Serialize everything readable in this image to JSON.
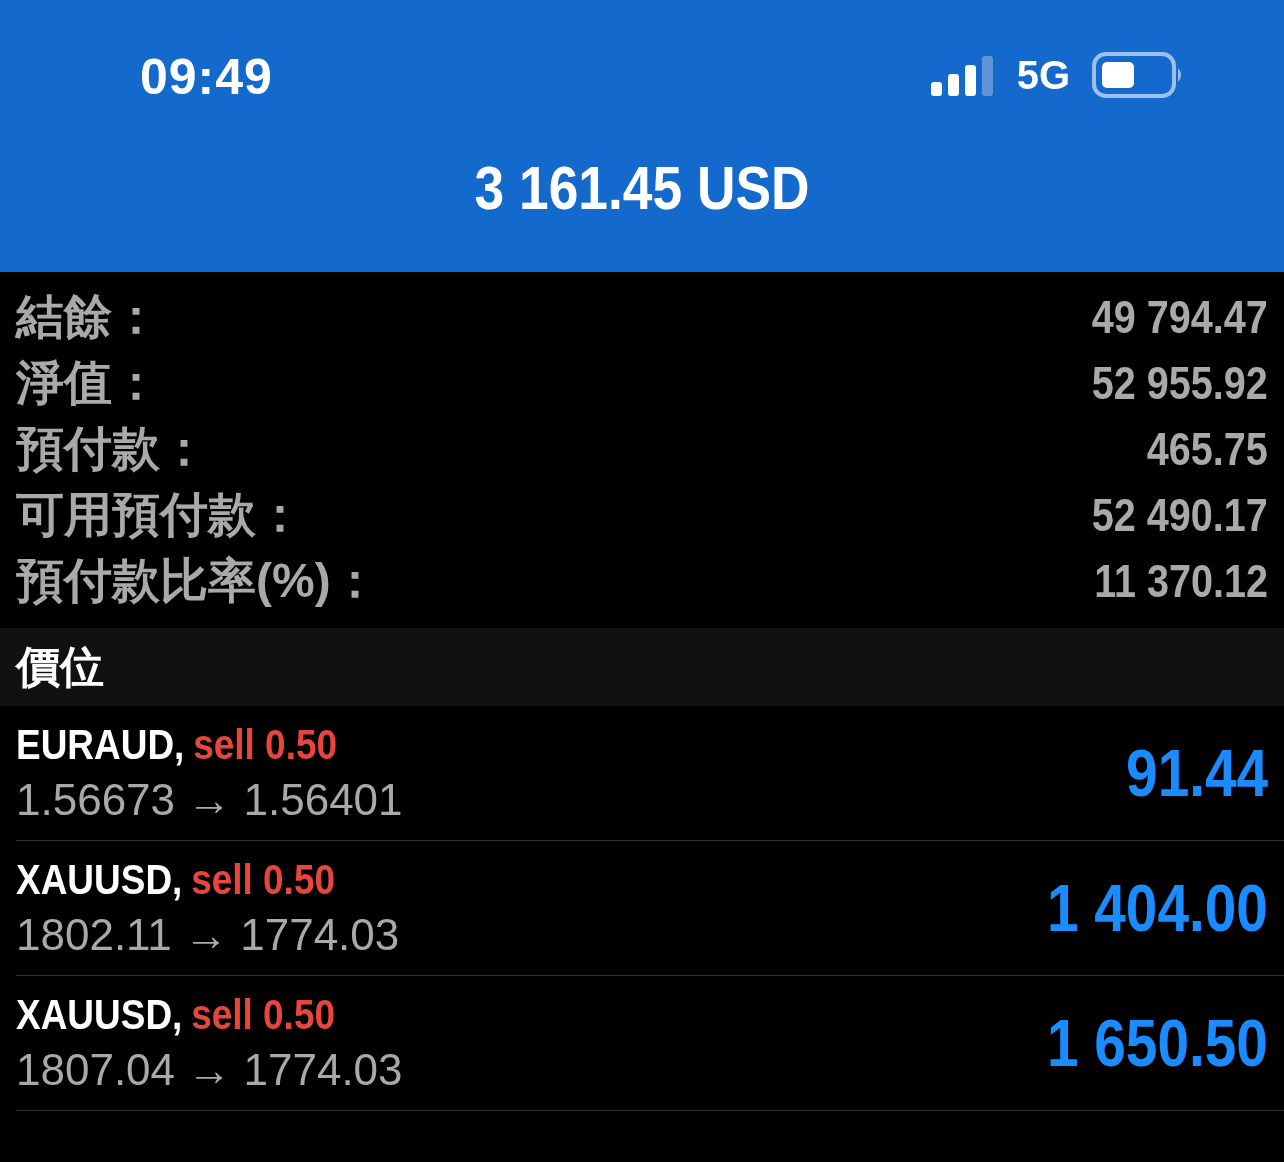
{
  "status_bar": {
    "time": "09:49",
    "network": "5G"
  },
  "header": {
    "title": "3 161.45 USD"
  },
  "summary": [
    {
      "label": "結餘：",
      "value": "49 794.47"
    },
    {
      "label": "淨值：",
      "value": "52 955.92"
    },
    {
      "label": "預付款：",
      "value": "465.75"
    },
    {
      "label": "可用預付款：",
      "value": "52 490.17"
    },
    {
      "label": "預付款比率(%)：",
      "value": "11 370.12"
    }
  ],
  "positions_section": {
    "title": "價位"
  },
  "positions": [
    {
      "symbol": "EURAUD,",
      "order": "sell 0.50",
      "prices": "1.56673 → 1.56401",
      "profit": "91.44"
    },
    {
      "symbol": "XAUUSD,",
      "order": "sell 0.50",
      "prices": "1802.11 → 1774.03",
      "profit": "1 404.00"
    },
    {
      "symbol": "XAUUSD,",
      "order": "sell 0.50",
      "prices": "1807.04 → 1774.03",
      "profit": "1 650.50"
    }
  ]
}
